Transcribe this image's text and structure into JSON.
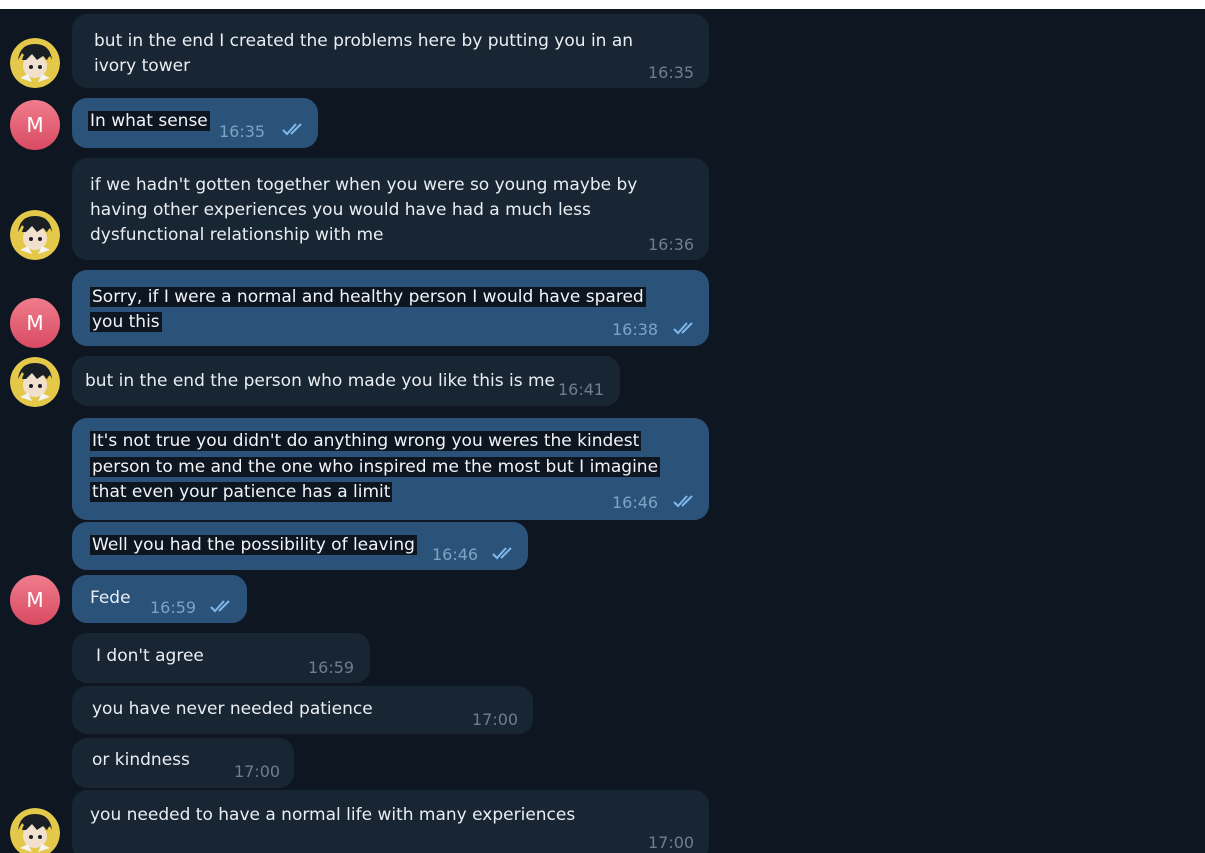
{
  "avatars": {
    "peer_label": "M"
  },
  "messages": [
    {
      "id": "m1",
      "direction": "in",
      "lines": [
        "but in the end I created the problems here by putting you in an",
        "ivory tower"
      ],
      "time": "16:35"
    },
    {
      "id": "m2",
      "direction": "out",
      "lines": [
        "In what sense"
      ],
      "time": "16:35",
      "read": true
    },
    {
      "id": "m3",
      "direction": "in",
      "lines": [
        "if we hadn't gotten together when you were so young maybe by",
        "having other experiences you would have had a much less",
        "dysfunctional relationship with me"
      ],
      "time": "16:36"
    },
    {
      "id": "m4",
      "direction": "out",
      "lines": [
        "Sorry, if I were a normal and healthy person I would have spared",
        "you this"
      ],
      "time": "16:38",
      "read": true
    },
    {
      "id": "m5",
      "direction": "in",
      "lines": [
        "but in the end the person who made you like this is me"
      ],
      "time": "16:41"
    },
    {
      "id": "m6",
      "direction": "out",
      "lines": [
        "It's not true you didn't do anything wrong you weres the kindest",
        "person to me and the one who inspired me the most but I imagine",
        "that even your patience has a limit"
      ],
      "time": "16:46",
      "read": true
    },
    {
      "id": "m7",
      "direction": "out",
      "lines": [
        "Well you had the possibility of leaving"
      ],
      "time": "16:46",
      "read": true
    },
    {
      "id": "m8",
      "direction": "out",
      "lines": [
        "Fede"
      ],
      "time": "16:59",
      "read": true
    },
    {
      "id": "m9",
      "direction": "in",
      "lines": [
        "I don't agree"
      ],
      "time": "16:59"
    },
    {
      "id": "m10",
      "direction": "in",
      "lines": [
        "you have never needed patience"
      ],
      "time": "17:00"
    },
    {
      "id": "m11",
      "direction": "in",
      "lines": [
        "or kindness"
      ],
      "time": "17:00"
    },
    {
      "id": "m12",
      "direction": "in",
      "lines": [
        "you needed to have a normal life with many experiences"
      ],
      "time": "17:00"
    }
  ],
  "colors": {
    "background": "#0e1621",
    "incoming_bubble": "#182533",
    "outgoing_bubble": "#2b5278",
    "text_highlight": "#0d1520",
    "read_check": "#7eb8ec",
    "avatar_m": "#e05a70"
  },
  "icons": {
    "read_status": "double-check-icon",
    "peer_avatar": "anime-character-avatar"
  }
}
